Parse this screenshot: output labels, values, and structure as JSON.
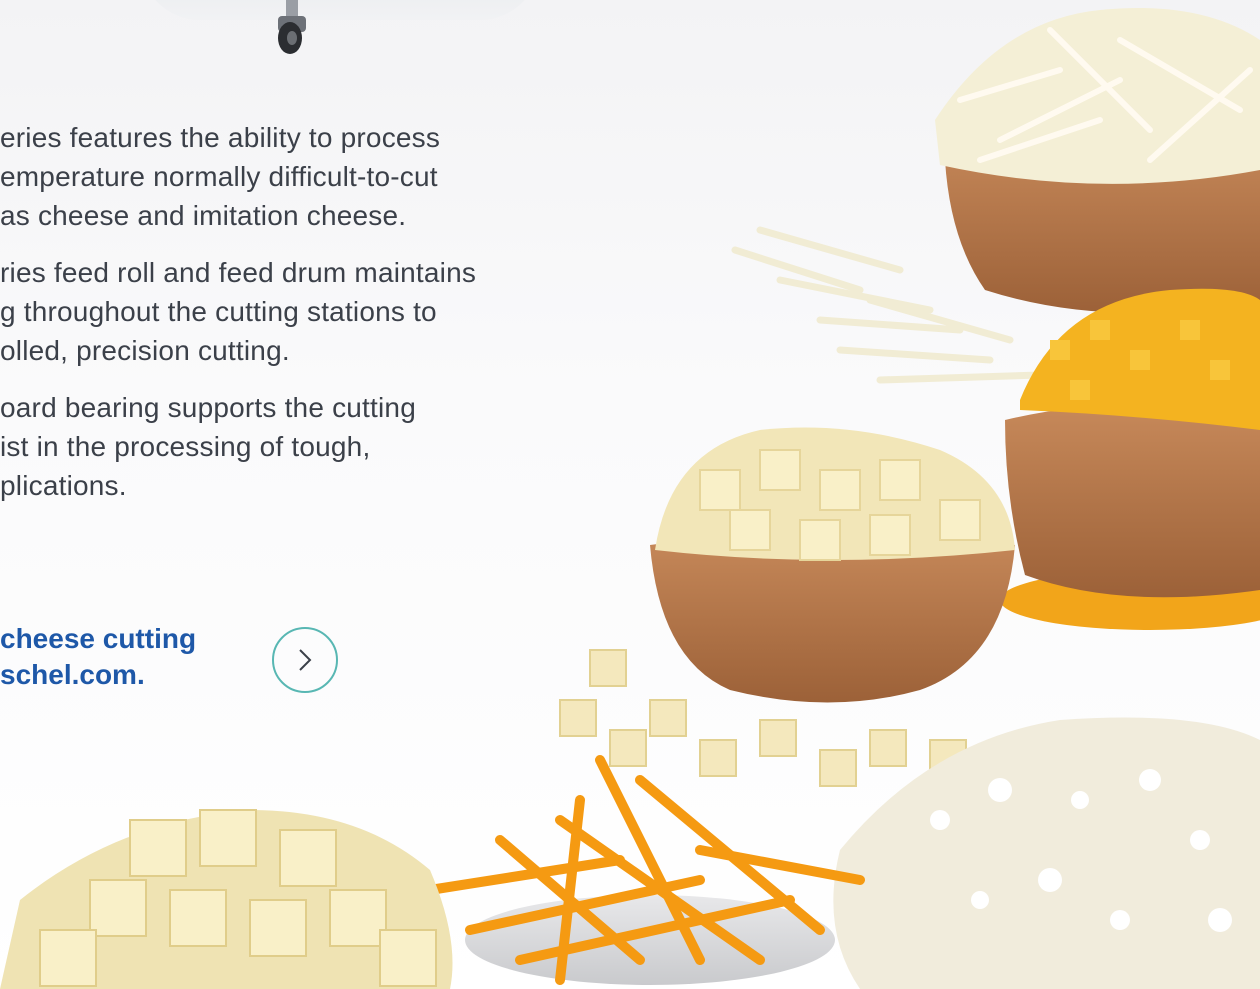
{
  "bullets": [
    "eries features the ability to process\nemperature normally difficult-to-cut\n as cheese and imitation cheese.",
    "ries feed roll and feed drum maintains\ng throughout the cutting stations to\nolled, precision cutting.",
    "oard bearing supports the cutting\nist in the processing of tough,\nplications."
  ],
  "cta": {
    "text": "cheese cutting\nschel.com.",
    "icon": "chevron-right-icon"
  },
  "colors": {
    "body_text": "#3b4049",
    "link_blue": "#1e58a8",
    "teal_ring": "#58b7b3",
    "wood": "#b97a4a",
    "cheddar": "#f2a51a",
    "cheese_white": "#f4ecd2"
  }
}
